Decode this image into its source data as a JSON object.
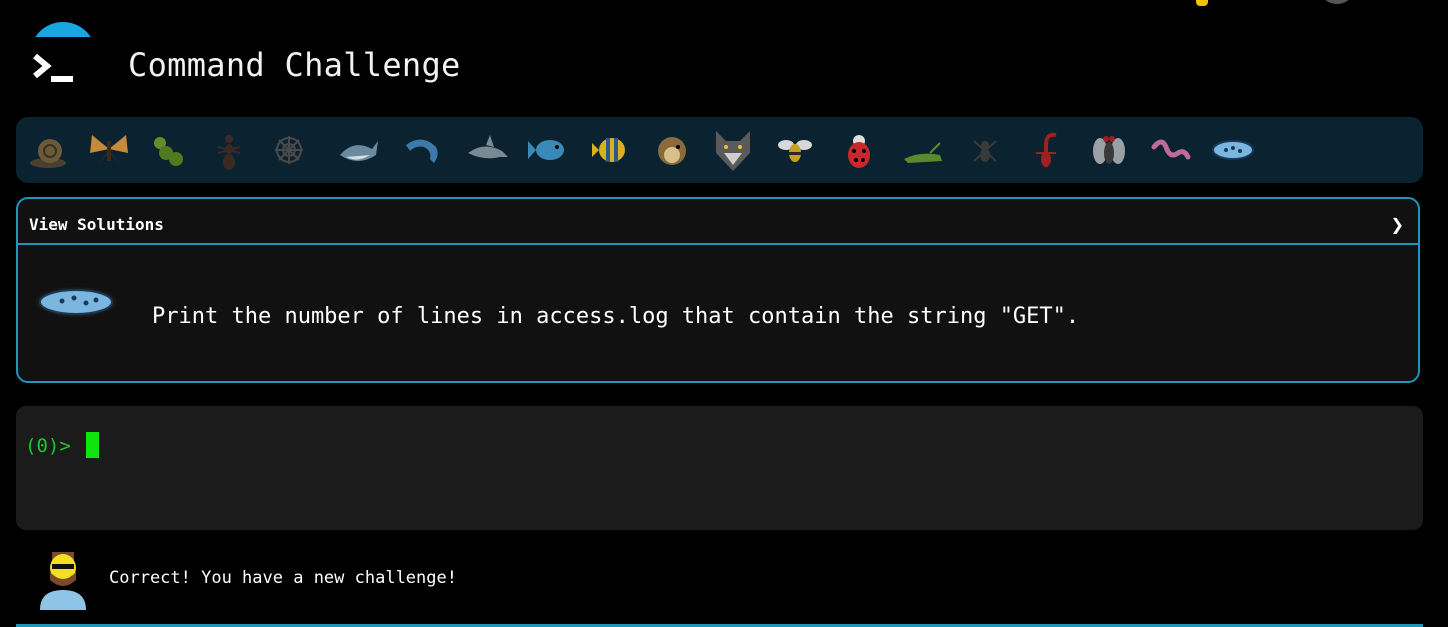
{
  "header": {
    "title": "Command Challenge",
    "accent_color": "#1aa6e0"
  },
  "creatures": [
    "snail-icon",
    "butterfly-icon",
    "caterpillar-icon",
    "ant-icon",
    "spider-web-icon",
    "whale-icon",
    "dolphin-icon",
    "shark-icon",
    "fish-icon",
    "tropical-fish-icon",
    "blowfish-icon",
    "wolf-icon",
    "bee-icon",
    "ladybug-icon",
    "cricket-icon",
    "spider-icon",
    "scorpion-icon",
    "fly-icon",
    "worm-icon",
    "microbe-icon"
  ],
  "solutions": {
    "label": "View Solutions",
    "chevron": "❯",
    "challenge_icon": "microbe-icon",
    "challenge_text": "Print the number of lines in access.log that contain the string \"GET\"."
  },
  "terminal": {
    "prompt": "(0)>",
    "input_value": ""
  },
  "status": {
    "avatar": "bearded-man-avatar",
    "message": "Correct! You have a new challenge!"
  }
}
